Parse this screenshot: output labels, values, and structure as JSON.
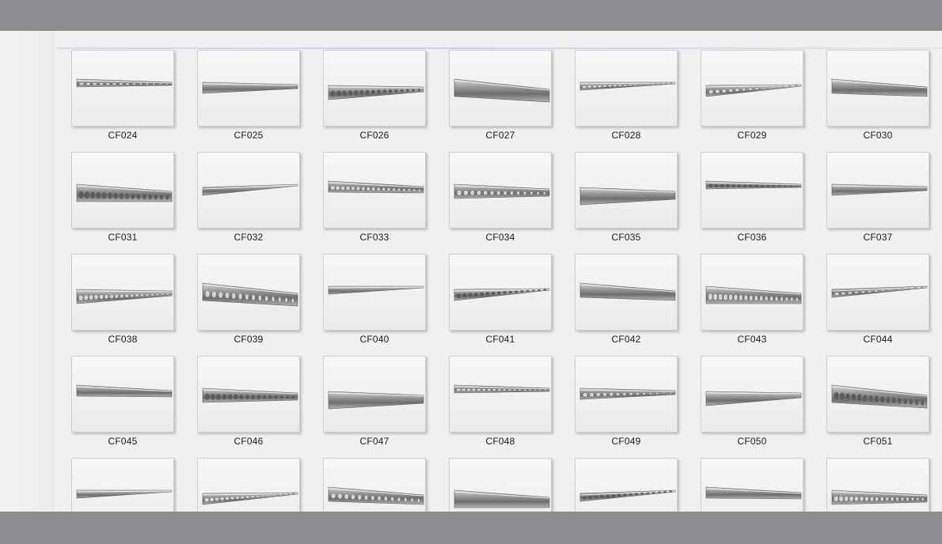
{
  "window": {
    "frame_color": "#8e8d91",
    "content_bg": "#f0f0f0"
  },
  "files": [
    {
      "name": "CF024",
      "icon": "moulding-thumbnail"
    },
    {
      "name": "CF025",
      "icon": "moulding-thumbnail"
    },
    {
      "name": "CF026",
      "icon": "moulding-thumbnail"
    },
    {
      "name": "CF027",
      "icon": "moulding-thumbnail"
    },
    {
      "name": "CF028",
      "icon": "moulding-thumbnail"
    },
    {
      "name": "CF029",
      "icon": "moulding-thumbnail"
    },
    {
      "name": "CF030",
      "icon": "moulding-thumbnail"
    },
    {
      "name": "CF031",
      "icon": "moulding-thumbnail"
    },
    {
      "name": "CF032",
      "icon": "moulding-thumbnail"
    },
    {
      "name": "CF033",
      "icon": "moulding-thumbnail"
    },
    {
      "name": "CF034",
      "icon": "moulding-thumbnail"
    },
    {
      "name": "CF035",
      "icon": "moulding-thumbnail"
    },
    {
      "name": "CF036",
      "icon": "moulding-thumbnail"
    },
    {
      "name": "CF037",
      "icon": "moulding-thumbnail"
    },
    {
      "name": "CF038",
      "icon": "moulding-thumbnail"
    },
    {
      "name": "CF039",
      "icon": "moulding-thumbnail"
    },
    {
      "name": "CF040",
      "icon": "moulding-thumbnail"
    },
    {
      "name": "CF041",
      "icon": "moulding-thumbnail"
    },
    {
      "name": "CF042",
      "icon": "moulding-thumbnail"
    },
    {
      "name": "CF043",
      "icon": "moulding-thumbnail"
    },
    {
      "name": "CF044",
      "icon": "moulding-thumbnail"
    },
    {
      "name": "CF045",
      "icon": "moulding-thumbnail"
    },
    {
      "name": "CF046",
      "icon": "moulding-thumbnail"
    },
    {
      "name": "CF047",
      "icon": "moulding-thumbnail"
    },
    {
      "name": "CF048",
      "icon": "moulding-thumbnail"
    },
    {
      "name": "CF049",
      "icon": "moulding-thumbnail"
    },
    {
      "name": "CF050",
      "icon": "moulding-thumbnail"
    },
    {
      "name": "CF051",
      "icon": "moulding-thumbnail"
    },
    {
      "name": "",
      "icon": "moulding-thumbnail"
    },
    {
      "name": "",
      "icon": "moulding-thumbnail"
    },
    {
      "name": "",
      "icon": "moulding-thumbnail"
    },
    {
      "name": "",
      "icon": "moulding-thumbnail"
    },
    {
      "name": "",
      "icon": "moulding-thumbnail"
    },
    {
      "name": "",
      "icon": "moulding-thumbnail"
    },
    {
      "name": "",
      "icon": "moulding-thumbnail"
    }
  ]
}
